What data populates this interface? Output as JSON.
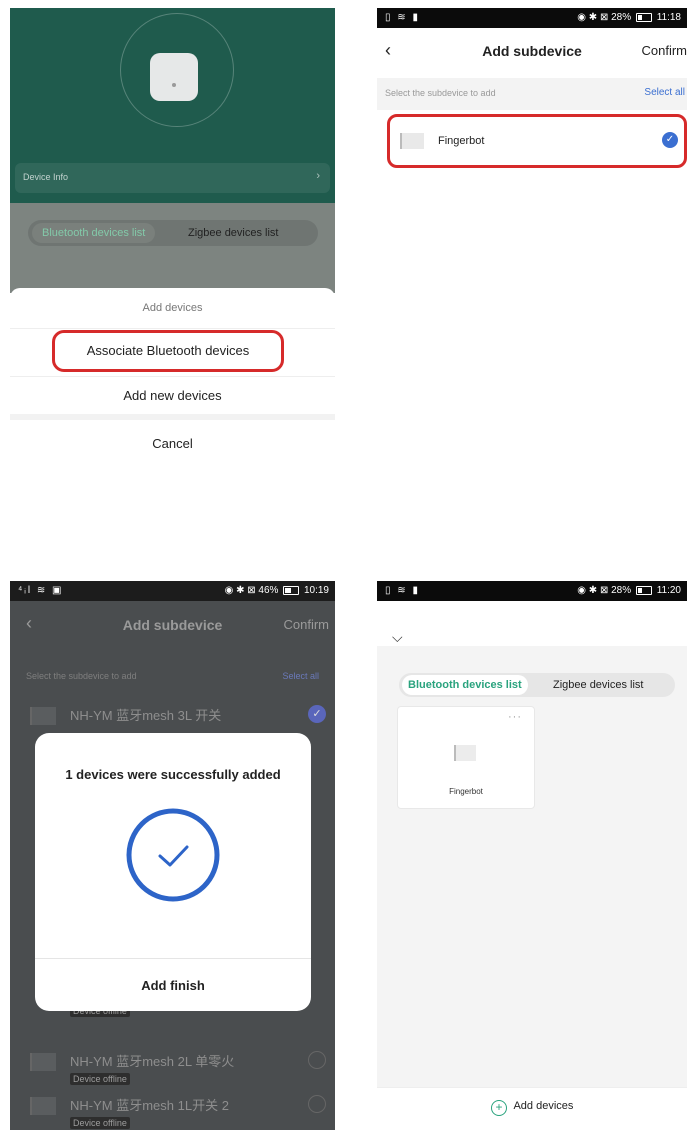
{
  "panel1": {
    "device_info": "Device Info",
    "device_info_chevron": "›",
    "tabs": [
      "Bluetooth devices list",
      "Zigbee devices list"
    ],
    "sheet_title": "Add devices",
    "associate": "Associate Bluetooth devices",
    "add_new": "Add new devices",
    "cancel": "Cancel"
  },
  "panel2": {
    "status": {
      "left": "▯ ≋ ▮",
      "right": "◉ ✱ ⊠ 28%",
      "time": "11:18"
    },
    "back": "‹",
    "title": "Add subdevice",
    "confirm": "Confirm",
    "prompt": "Select the subdevice to add",
    "select_all": "Select all",
    "item": "Fingerbot",
    "check": "✓"
  },
  "panel3": {
    "status": {
      "left": "⁴ᵢl ≋ ▣",
      "right": "◉ ✱ ⊠ 46%",
      "time": "10:19"
    },
    "back": "‹",
    "title": "Add subdevice",
    "confirm": "Confirm",
    "prompt": "Select the subdevice to add",
    "select_all": "Select all",
    "rows": [
      {
        "name": "NH-YM 蓝牙mesh 3L 开关"
      },
      {
        "name": "NH-YM 蓝牙mesh 2L 单零火",
        "badge": "Device offline"
      },
      {
        "name": "NH-YM 蓝牙mesh 1L开关 2",
        "badge": "Device offline"
      }
    ],
    "extra_badge": "Device offline",
    "check": "✓",
    "dialog_message": "1 devices were successfully added",
    "dialog_button": "Add finish"
  },
  "panel4": {
    "status": {
      "left": "▯ ≋ ▮",
      "right": "◉ ✱ ⊠ 28%",
      "time": "11:20"
    },
    "chevron": "⌵",
    "tabs": [
      "Bluetooth devices list",
      "Zigbee devices list"
    ],
    "card_name": "Fingerbot",
    "card_menu": "···",
    "add_button": "Add devices",
    "add_plus": "+"
  },
  "colors": {
    "highlight": "#d62a2a",
    "accent_blue": "#3b6fd1",
    "accent_green": "#2aa37e"
  }
}
